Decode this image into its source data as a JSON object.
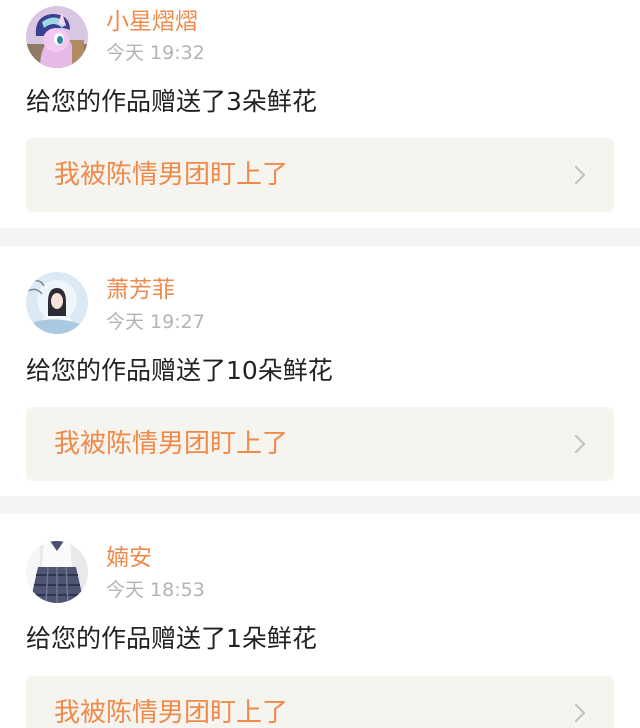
{
  "notifications": [
    {
      "username": "小星熠熠",
      "time": "今天 19:32",
      "message": "给您的作品赠送了3朵鲜花",
      "work_title": "我被陈情男团盯上了",
      "avatar": "pony-avatar"
    },
    {
      "username": "萧芳菲",
      "time": "今天 19:27",
      "message": "给您的作品赠送了10朵鲜花",
      "work_title": "我被陈情男团盯上了",
      "avatar": "ancient-lady-avatar"
    },
    {
      "username": "婻安",
      "time": "今天 18:53",
      "message": "给您的作品赠送了1朵鲜花",
      "work_title": "我被陈情男团盯上了",
      "avatar": "school-uniform-avatar"
    }
  ],
  "colors": {
    "accent": "#f08a4b",
    "timestamp": "#b3b3b3",
    "link_background": "#f5f4ef",
    "separator": "#f4f4f4"
  },
  "icons": {
    "chevron": "chevron-right-icon"
  }
}
